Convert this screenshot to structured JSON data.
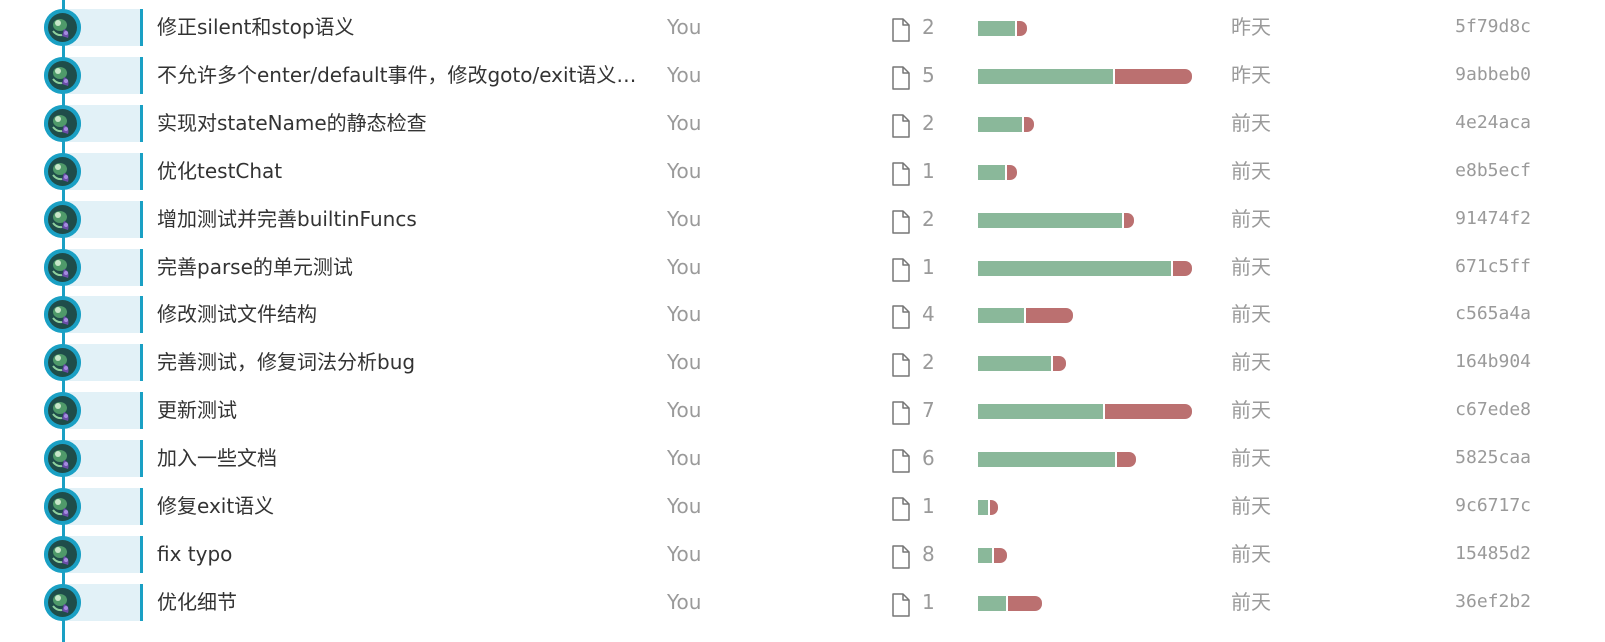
{
  "commits": [
    {
      "message": "修正silent和stop语义",
      "author": "You",
      "files": "2",
      "add": 0.175,
      "del": 0.045,
      "date": "昨天",
      "hash": "5f79d8c"
    },
    {
      "message": "不允许多个enter/default事件，修改goto/exit语义，...",
      "author": "You",
      "files": "5",
      "add": 0.635,
      "del": 0.365,
      "date": "昨天",
      "hash": "9abbeb0"
    },
    {
      "message": "实现对stateName的静态检查",
      "author": "You",
      "files": "2",
      "add": 0.207,
      "del": 0.045,
      "date": "前天",
      "hash": "4e24aca"
    },
    {
      "message": "优化testChat",
      "author": "You",
      "files": "1",
      "add": 0.126,
      "del": 0.048,
      "date": "前天",
      "hash": "e8b5ecf"
    },
    {
      "message": "增加测试并完善builtinFuncs",
      "author": "You",
      "files": "2",
      "add": 0.68,
      "del": 0.045,
      "date": "前天",
      "hash": "91474f2"
    },
    {
      "message": "完善parse的单元测试",
      "author": "You",
      "files": "1",
      "add": 0.91,
      "del": 0.09,
      "date": "前天",
      "hash": "671c5ff"
    },
    {
      "message": "修改测试文件结构",
      "author": "You",
      "files": "4",
      "add": 0.215,
      "del": 0.22,
      "date": "前天",
      "hash": "c565a4a"
    },
    {
      "message": "完善测试，修复词法分析bug",
      "author": "You",
      "files": "2",
      "add": 0.345,
      "del": 0.06,
      "date": "前天",
      "hash": "164b904"
    },
    {
      "message": "更新测试",
      "author": "You",
      "files": "7",
      "add": 0.59,
      "del": 0.41,
      "date": "前天",
      "hash": "c67ede8"
    },
    {
      "message": "加入一些文档",
      "author": "You",
      "files": "6",
      "add": 0.648,
      "del": 0.09,
      "date": "前天",
      "hash": "5825caa"
    },
    {
      "message": "修复exit语义",
      "author": "You",
      "files": "1",
      "add": 0.045,
      "del": 0.04,
      "date": "前天",
      "hash": "9c6717c"
    },
    {
      "message": "fix typo",
      "author": "You",
      "files": "8",
      "add": 0.065,
      "del": 0.062,
      "date": "前天",
      "hash": "15485d2"
    },
    {
      "message": "优化细节",
      "author": "You",
      "files": "1",
      "add": 0.13,
      "del": 0.16,
      "date": "前天",
      "hash": "36ef2b2"
    }
  ],
  "colors": {
    "graph": "#1aa0c4",
    "row_highlight": "#e2f1f7",
    "additions": "#8ab89a",
    "deletions": "#bb7070"
  },
  "icons": {
    "avatar": "user-avatar",
    "files": "file-icon"
  }
}
